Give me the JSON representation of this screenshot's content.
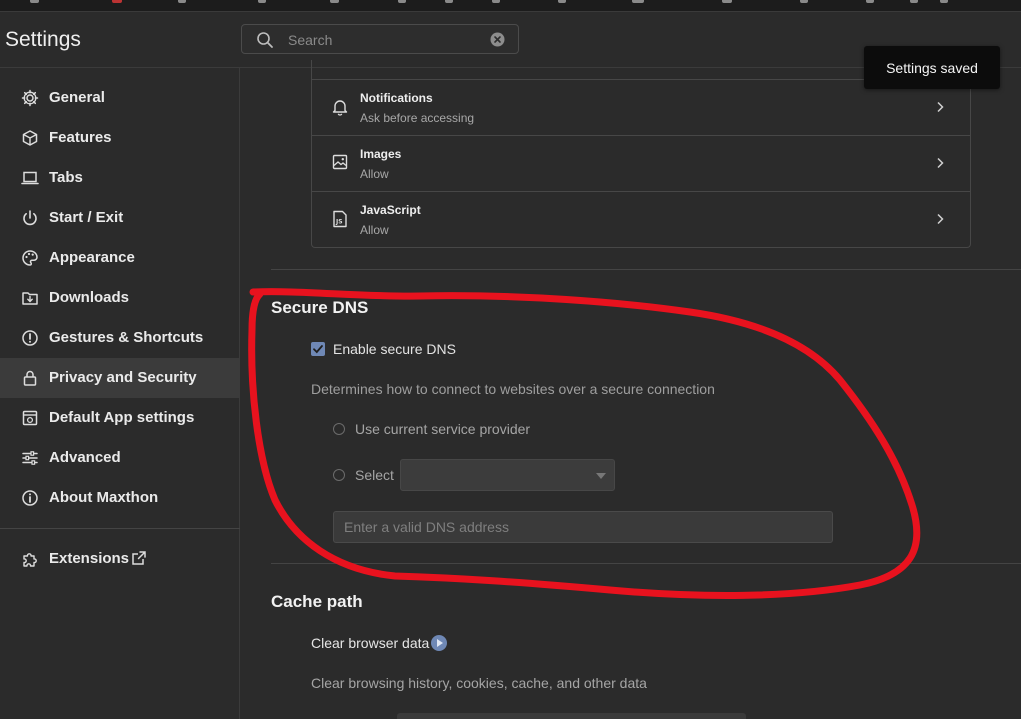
{
  "app": {
    "title": "Settings"
  },
  "search": {
    "placeholder": "Search",
    "value": ""
  },
  "sidebar": {
    "items": [
      {
        "label": "General",
        "icon": "gear-icon"
      },
      {
        "label": "Features",
        "icon": "cube-icon"
      },
      {
        "label": "Tabs",
        "icon": "laptop-icon"
      },
      {
        "label": "Start / Exit",
        "icon": "power-icon"
      },
      {
        "label": "Appearance",
        "icon": "palette-icon"
      },
      {
        "label": "Downloads",
        "icon": "download-folder-icon"
      },
      {
        "label": "Gestures & Shortcuts",
        "icon": "gesture-icon"
      },
      {
        "label": "Privacy and Security",
        "icon": "lock-icon",
        "active": true
      },
      {
        "label": "Default App settings",
        "icon": "app-window-icon"
      },
      {
        "label": "Advanced",
        "icon": "sliders-icon"
      },
      {
        "label": "About Maxthon",
        "icon": "info-icon"
      }
    ],
    "extensions": {
      "label": "Extensions",
      "icon": "puzzle-icon",
      "external_icon": "external-link-icon"
    }
  },
  "permissions": [
    {
      "title": "Notifications",
      "subtitle": "Ask before accessing",
      "icon": "bell-icon"
    },
    {
      "title": "Images",
      "subtitle": "Allow",
      "icon": "image-icon"
    },
    {
      "title": "JavaScript",
      "subtitle": "Allow",
      "icon": "js-file-icon"
    }
  ],
  "secure_dns": {
    "title": "Secure DNS",
    "enable_label": "Enable secure DNS",
    "enabled": true,
    "description": "Determines how to connect to websites over a secure connection",
    "option_current": "Use current service provider",
    "option_select": "Select",
    "select_value": "",
    "dns_placeholder": "Enter a valid DNS address"
  },
  "cache": {
    "title": "Cache path",
    "clear_label": "Clear browser data",
    "clear_description": "Clear browsing history, cookies, cache, and other data"
  },
  "toast": {
    "text": "Settings saved"
  },
  "colors": {
    "background": "#2b2b2b",
    "accent": "#6f88b5",
    "annotation": "#e8121e",
    "toast_bg": "#0c0c0c"
  }
}
